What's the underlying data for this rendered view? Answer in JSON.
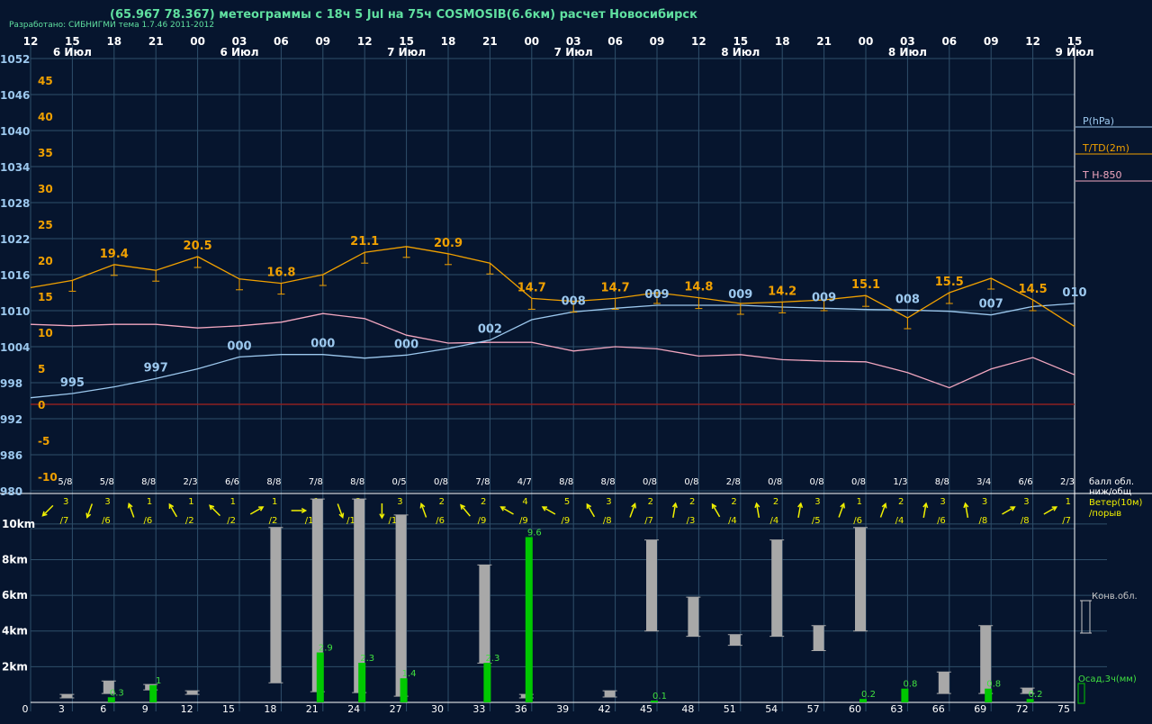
{
  "header": {
    "title": "(65.967 78.367) метеограммы с  18ч 5 Jul на 75ч COSMOSIB(6.6км) расчет Новосибирск",
    "developed": "Разработано: СИБНИГМИ тема 1.7.46 2011-2012"
  },
  "colors": {
    "background": "#06152e",
    "grid": "#2f4f6a",
    "pressure": "#9cc8ee",
    "temperature": "#f0a000",
    "t850": "#f2a7c0",
    "zero_line": "#8b2020",
    "wind": "#f0f000",
    "cloud": "#a8a8a8",
    "precip": "#00c800",
    "precip_label": "#40e040",
    "axis_text": "#ffffff",
    "legend_text": "#c8c8c8"
  },
  "chart_data": {
    "type": "line",
    "hour_labels": [
      "12",
      "15",
      "18",
      "21",
      "00",
      "03",
      "06",
      "09",
      "12",
      "15",
      "18",
      "21",
      "00",
      "03",
      "06",
      "09",
      "12",
      "15",
      "18",
      "21",
      "00",
      "03",
      "06",
      "09",
      "12",
      "15"
    ],
    "date_labels": [
      {
        "index": 1,
        "text": "6 Июл"
      },
      {
        "index": 5,
        "text": "6 Июл"
      },
      {
        "index": 9,
        "text": "7 Июл"
      },
      {
        "index": 13,
        "text": "7 Июл"
      },
      {
        "index": 17,
        "text": "8 Июл"
      },
      {
        "index": 21,
        "text": "8 Июл"
      },
      {
        "index": 25,
        "text": "9 Июл"
      }
    ],
    "pressure_axis": {
      "ticks": [
        "1052",
        "1046",
        "1040",
        "1034",
        "1028",
        "1022",
        "1016",
        "1010",
        "1004",
        "998",
        "992",
        "986",
        "980"
      ],
      "ylim": [
        980,
        1052
      ]
    },
    "temp_axis": {
      "ticks": [
        "45",
        "40",
        "35",
        "30",
        "25",
        "20",
        "15",
        "10",
        "5",
        "0",
        "-5",
        "-10"
      ],
      "ylim": [
        -12,
        48
      ]
    },
    "lead_hours": [
      "0",
      "3",
      "6",
      "9",
      "12",
      "15",
      "18",
      "21",
      "24",
      "27",
      "30",
      "33",
      "36",
      "39",
      "42",
      "45",
      "48",
      "51",
      "54",
      "57",
      "60",
      "63",
      "66",
      "69",
      "72",
      "75"
    ],
    "series": [
      {
        "name": "P(hPa)",
        "values": [
          995.5,
          996.2,
          997.3,
          998.7,
          1000.3,
          1002.3,
          1002.7,
          1002.7,
          1002.1,
          1002.6,
          1003.7,
          1005.1,
          1008.5,
          1009.8,
          1010.4,
          1010.9,
          1010.9,
          1010.9,
          1010.6,
          1010.4,
          1010.2,
          1010.1,
          1009.9,
          1009.3,
          1010.7,
          1011.2
        ]
      },
      {
        "name": "T/TD(2m)",
        "values": [
          16.2,
          17.2,
          19.4,
          18.6,
          20.5,
          17.4,
          16.8,
          18.0,
          21.1,
          21.9,
          20.9,
          19.6,
          14.7,
          14.3,
          14.7,
          15.5,
          14.8,
          14.0,
          14.2,
          14.5,
          15.1,
          12.0,
          15.5,
          17.5,
          14.5,
          10.8
        ]
      },
      {
        "name": "T H-850",
        "values": [
          11.1,
          10.9,
          11.1,
          11.1,
          10.6,
          10.9,
          11.4,
          12.6,
          11.9,
          9.6,
          8.5,
          8.6,
          8.6,
          7.4,
          8.0,
          7.7,
          6.7,
          6.9,
          6.2,
          6.0,
          5.9,
          4.4,
          2.3,
          4.9,
          6.5,
          4.1
        ]
      }
    ],
    "pressure_labels": [
      {
        "index": 1,
        "text": "995"
      },
      {
        "index": 3,
        "text": "997"
      },
      {
        "index": 5,
        "text": "000"
      },
      {
        "index": 7,
        "text": "000"
      },
      {
        "index": 9,
        "text": "000"
      },
      {
        "index": 11,
        "text": "002"
      },
      {
        "index": 13,
        "text": "008"
      },
      {
        "index": 15,
        "text": "009"
      },
      {
        "index": 17,
        "text": "009"
      },
      {
        "index": 19,
        "text": "009"
      },
      {
        "index": 21,
        "text": "008"
      },
      {
        "index": 23,
        "text": "007"
      },
      {
        "index": 25,
        "text": "010"
      }
    ],
    "temp_labels": [
      {
        "index": 2,
        "text": "19.4"
      },
      {
        "index": 4,
        "text": "20.5"
      },
      {
        "index": 6,
        "text": "16.8"
      },
      {
        "index": 8,
        "text": "21.1"
      },
      {
        "index": 10,
        "text": "20.9"
      },
      {
        "index": 12,
        "text": "14.7"
      },
      {
        "index": 14,
        "text": "14.7"
      },
      {
        "index": 16,
        "text": "14.8"
      },
      {
        "index": 18,
        "text": "14.2"
      },
      {
        "index": 20,
        "text": "15.1"
      },
      {
        "index": 22,
        "text": "15.5"
      },
      {
        "index": 24,
        "text": "14.5"
      }
    ],
    "cloud_cover": [
      "5/8",
      "5/8",
      "8/8",
      "2/3",
      "6/6",
      "8/8",
      "7/8",
      "8/8",
      "0/5",
      "0/8",
      "7/8",
      "4/7",
      "8/8",
      "8/8",
      "0/8",
      "0/8",
      "2/8",
      "0/8",
      "0/8",
      "0/8",
      "1/3",
      "8/8",
      "3/4",
      "6/6",
      "2/3"
    ],
    "wind": [
      {
        "speed": "3",
        "gust": "/7",
        "dir": 225
      },
      {
        "speed": "3",
        "gust": "/6",
        "dir": 200
      },
      {
        "speed": "1",
        "gust": "/6",
        "dir": 340
      },
      {
        "speed": "1",
        "gust": "/2",
        "dir": 330
      },
      {
        "speed": "1",
        "gust": "/2",
        "dir": 315
      },
      {
        "speed": "1",
        "gust": "/2",
        "dir": 60
      },
      {
        "speed": "1",
        "gust": "/12",
        "dir": 90
      },
      {
        "speed": "3",
        "gust": "/11",
        "dir": 160
      },
      {
        "speed": "3",
        "gust": "/12",
        "dir": 180
      },
      {
        "speed": "2",
        "gust": "/6",
        "dir": 340
      },
      {
        "speed": "2",
        "gust": "/9",
        "dir": 320
      },
      {
        "speed": "4",
        "gust": "/9",
        "dir": 300
      },
      {
        "speed": "5",
        "gust": "/9",
        "dir": 300
      },
      {
        "speed": "3",
        "gust": "/8",
        "dir": 330
      },
      {
        "speed": "2",
        "gust": "/7",
        "dir": 20
      },
      {
        "speed": "2",
        "gust": "/3",
        "dir": 10
      },
      {
        "speed": "2",
        "gust": "/4",
        "dir": 330
      },
      {
        "speed": "2",
        "gust": "/4",
        "dir": 350
      },
      {
        "speed": "3",
        "gust": "/5",
        "dir": 10
      },
      {
        "speed": "1",
        "gust": "/6",
        "dir": 20
      },
      {
        "speed": "2",
        "gust": "/4",
        "dir": 20
      },
      {
        "speed": "3",
        "gust": "/6",
        "dir": 10
      },
      {
        "speed": "3",
        "gust": "/8",
        "dir": 350
      },
      {
        "speed": "3",
        "gust": "/8",
        "dir": 60
      },
      {
        "speed": "1",
        "gust": "/7",
        "dir": 60
      }
    ],
    "cloud_axis": {
      "ticks": [
        "10km",
        "8km",
        "6km",
        "4km",
        "2km"
      ],
      "ylim_km": [
        0,
        11
      ]
    },
    "conv_clouds": [
      {
        "index": 1,
        "bottom": 0.25,
        "top": 0.45
      },
      {
        "index": 2,
        "bottom": 0.5,
        "top": 1.2
      },
      {
        "index": 3,
        "bottom": 0.7,
        "top": 1.0
      },
      {
        "index": 4,
        "bottom": 0.45,
        "top": 0.65
      },
      {
        "index": 6,
        "bottom": 1.1,
        "top": 9.8
      },
      {
        "index": 7,
        "bottom": 0.6,
        "top": 11.4
      },
      {
        "index": 8,
        "bottom": 0.55,
        "top": 11.4
      },
      {
        "index": 9,
        "bottom": 0.35,
        "top": 10.5
      },
      {
        "index": 11,
        "bottom": 2.2,
        "top": 7.7
      },
      {
        "index": 12,
        "bottom": 0.25,
        "top": 0.45
      },
      {
        "index": 14,
        "bottom": 0.3,
        "top": 0.65
      },
      {
        "index": 15,
        "bottom": 4.0,
        "top": 9.1
      },
      {
        "index": 16,
        "bottom": 3.7,
        "top": 5.9
      },
      {
        "index": 17,
        "bottom": 3.2,
        "top": 3.8
      },
      {
        "index": 18,
        "bottom": 3.7,
        "top": 9.1
      },
      {
        "index": 19,
        "bottom": 2.9,
        "top": 4.3
      },
      {
        "index": 20,
        "bottom": 4.0,
        "top": 9.8
      },
      {
        "index": 22,
        "bottom": 0.5,
        "top": 1.7
      },
      {
        "index": 23,
        "bottom": 0.5,
        "top": 4.3
      },
      {
        "index": 24,
        "bottom": 0.5,
        "top": 0.8
      }
    ],
    "precip": [
      {
        "index": 2,
        "value": 0.3,
        "label": "0.3"
      },
      {
        "index": 3,
        "value": 1.0,
        "label": "1"
      },
      {
        "index": 7,
        "value": 2.9,
        "label": "2.9"
      },
      {
        "index": 8,
        "value": 2.3,
        "label": "2.3"
      },
      {
        "index": 9,
        "value": 1.4,
        "label": "1.4"
      },
      {
        "index": 11,
        "value": 2.3,
        "label": "2.3"
      },
      {
        "index": 12,
        "value": 9.6,
        "label": "9.6"
      },
      {
        "index": 15,
        "value": 0.1,
        "label": "0.1"
      },
      {
        "index": 20,
        "value": 0.2,
        "label": "0.2"
      },
      {
        "index": 21,
        "value": 0.8,
        "label": "0.8"
      },
      {
        "index": 23,
        "value": 0.8,
        "label": "0.8"
      },
      {
        "index": 24,
        "value": 0.2,
        "label": "0.2"
      }
    ],
    "precip_scale_max": 11.4
  },
  "legend": {
    "pressure": "P(hPa)",
    "temperature": "T/TD(2m)",
    "t850": "T H-850",
    "cloud_line1": "балл обл.",
    "cloud_line2": "ниж/общ",
    "wind_line1": "Ветер(10м)",
    "wind_line2": "/порыв",
    "conv": "Конв.обл.",
    "precip": "Осад,3ч(мм)"
  }
}
